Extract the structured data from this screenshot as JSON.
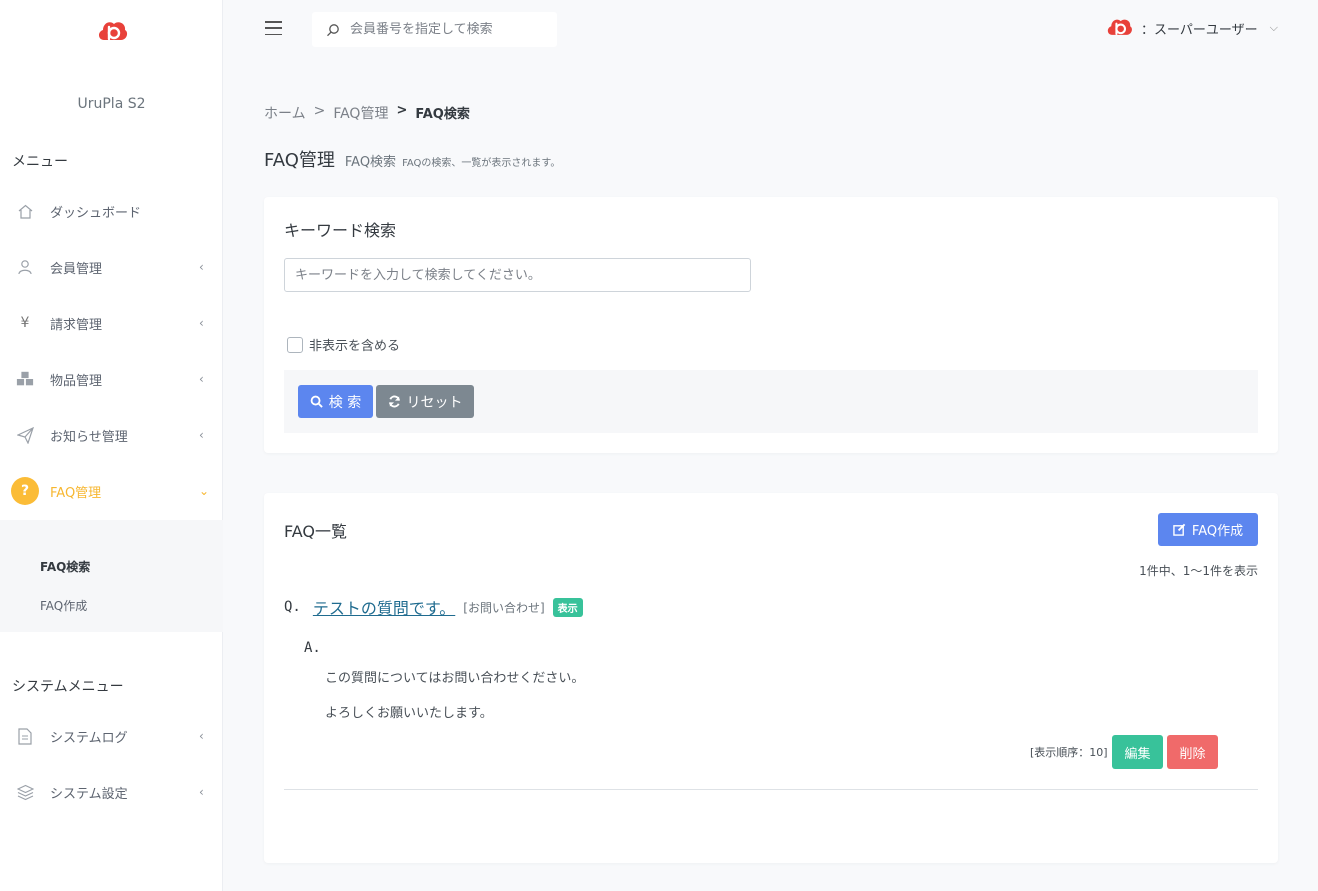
{
  "colors": {
    "primary": "#5c86ef",
    "secondary": "#7d8891",
    "success": "#38c29a",
    "danger": "#f06a6a",
    "warning": "#fbbc37",
    "logo": "#e8413a"
  },
  "sidebar": {
    "brand": "UruPla S2",
    "menu_heading": "メニュー",
    "items": [
      {
        "label": "ダッシュボード",
        "icon": "home-icon"
      },
      {
        "label": "会員管理",
        "icon": "user-icon"
      },
      {
        "label": "請求管理",
        "icon": "yen-icon",
        "glyph": "¥"
      },
      {
        "label": "物品管理",
        "icon": "cubes-icon"
      },
      {
        "label": "お知らせ管理",
        "icon": "paper-plane-icon"
      },
      {
        "label": "FAQ管理",
        "icon": "question-icon",
        "glyph": "?"
      }
    ],
    "submenu": [
      {
        "label": "FAQ検索"
      },
      {
        "label": "FAQ作成"
      }
    ],
    "system_heading": "システムメニュー",
    "system_items": [
      {
        "label": "システムログ",
        "icon": "document-icon"
      },
      {
        "label": "システム設定",
        "icon": "layers-icon"
      }
    ]
  },
  "topbar": {
    "search_placeholder": "会員番号を指定して検索",
    "user_name": "：スーパーユーザー"
  },
  "breadcrumb": {
    "home": "ホーム",
    "sep": ">",
    "parent": "FAQ管理",
    "current": "FAQ検索"
  },
  "header": {
    "title": "FAQ管理",
    "subtitle": "FAQ検索",
    "description": "FAQの検索、一覧が表示されます。"
  },
  "search_card": {
    "title": "キーワード検索",
    "keyword_placeholder": "キーワードを入力して検索してください。",
    "include_hidden_label": "非表示を含める",
    "search_label": "検 索",
    "reset_label": "リセット"
  },
  "list_card": {
    "title": "FAQ一覧",
    "create_label": "FAQ作成",
    "count_text": "1件中、1〜1件を表示",
    "faqs": [
      {
        "q_mark": "Q.",
        "question": "テストの質問です。",
        "category": "[お問い合わせ]",
        "status": "表示",
        "a_mark": "A.",
        "answer_lines": [
          "この質問についてはお問い合わせください。",
          "よろしくお願いいたします。"
        ],
        "order_text": "[表示順序：10]",
        "edit_label": "編集",
        "delete_label": "削除"
      }
    ]
  }
}
